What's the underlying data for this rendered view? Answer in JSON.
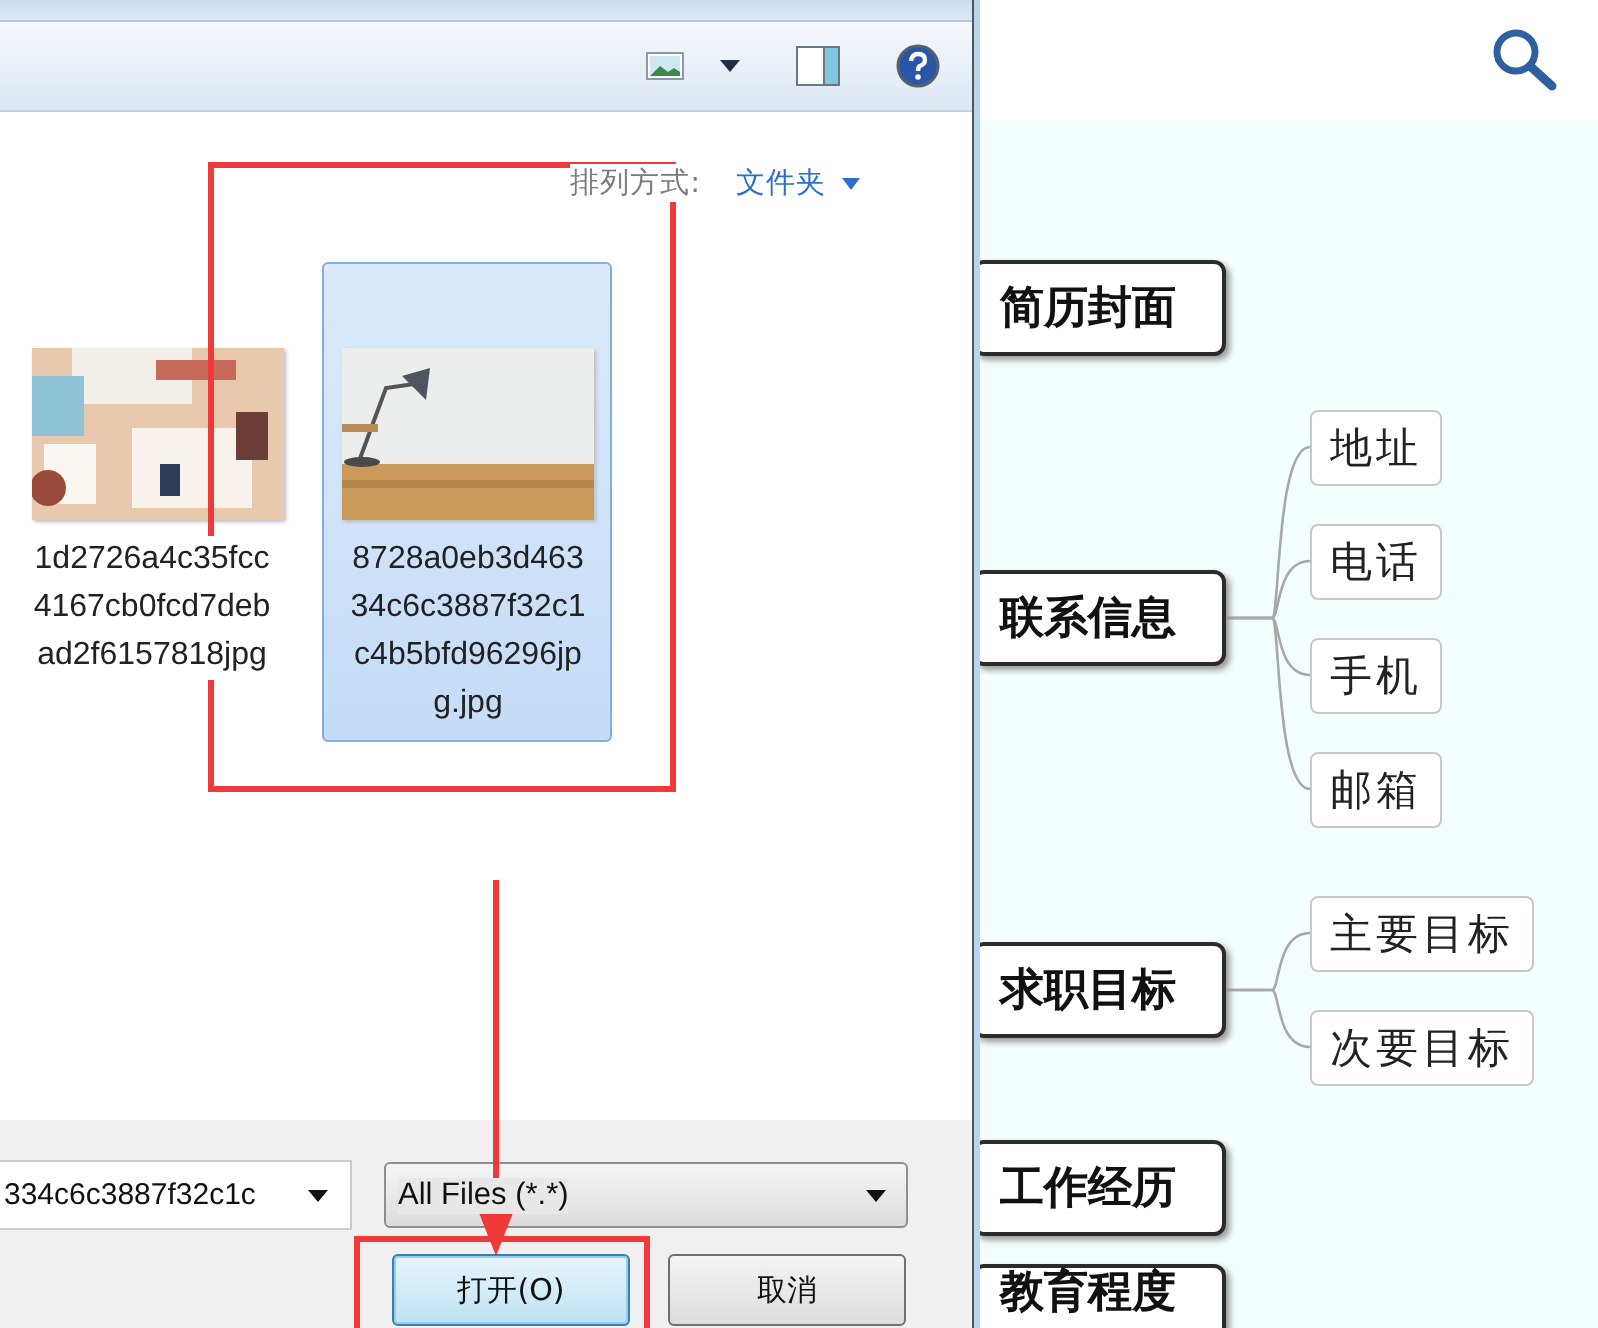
{
  "dialog": {
    "sort": {
      "label": "排列方式:",
      "value": "文件夹"
    },
    "files": [
      {
        "name": "1d2726a4c35fcc4167cb0fcd7debad2f6157818jpg",
        "selected": false
      },
      {
        "name": "8728a0eb3d46334c6c3887f32c1c4b5bfd96296jpg.jpg",
        "selected": true
      }
    ],
    "filename_field": {
      "value": "334c6c3887f32c1c"
    },
    "file_type": {
      "value": "All Files (*.*)"
    },
    "buttons": [
      "打开(O)",
      "取消"
    ]
  },
  "mindmap": {
    "nodes": [
      {
        "label": "简历封面"
      },
      {
        "label": "联系信息",
        "children": [
          {
            "label": "地址"
          },
          {
            "label": "电话"
          },
          {
            "label": "手机"
          },
          {
            "label": "邮箱"
          }
        ]
      },
      {
        "label": "求职目标",
        "children": [
          {
            "label": "主要目标"
          },
          {
            "label": "次要目标"
          }
        ]
      },
      {
        "label": "工作经历"
      },
      {
        "label": "教育程度"
      }
    ]
  }
}
